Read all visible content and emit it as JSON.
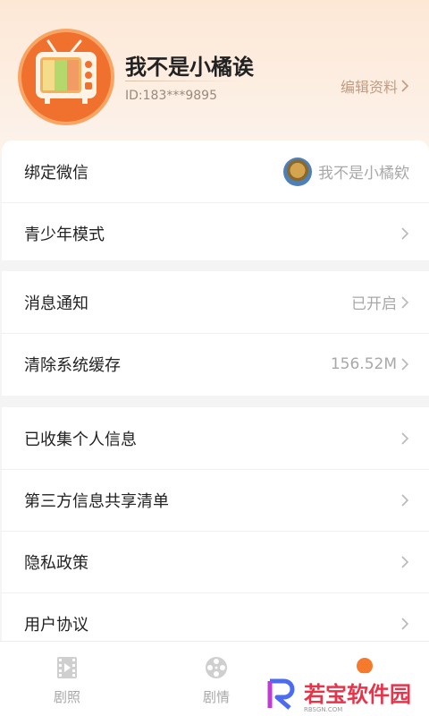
{
  "profile": {
    "nickname": "我不是小橘诶",
    "user_id": "ID:183***9895",
    "edit_label": "编辑资料"
  },
  "account": {
    "bind_wechat_label": "绑定微信",
    "wechat_name": "我不是小橘欸",
    "teen_mode_label": "青少年模式"
  },
  "settings": {
    "notification_label": "消息通知",
    "notification_status": "已开启",
    "clear_cache_label": "清除系统缓存",
    "cache_size": "156.52M"
  },
  "privacy": {
    "items": [
      {
        "label": "已收集个人信息"
      },
      {
        "label": "第三方信息共享清单"
      },
      {
        "label": "隐私政策"
      },
      {
        "label": "用户协议"
      }
    ]
  },
  "tabbar": {
    "tabs": [
      {
        "label": "剧照",
        "icon": "film-icon"
      },
      {
        "label": "剧情",
        "icon": "film-reel-icon"
      },
      {
        "label": "",
        "icon": "me-icon"
      }
    ]
  },
  "watermark": {
    "text": "若宝软件园",
    "sub": "RBSGN.COM"
  },
  "colors": {
    "accent": "#f0702e",
    "header_bg": "#fde8d6",
    "muted_text": "#a8a8a8",
    "edit_text": "#c29b80"
  }
}
